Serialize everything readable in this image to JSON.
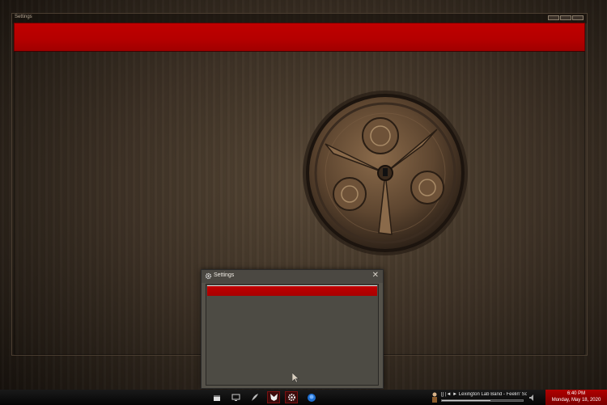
{
  "big_window": {
    "title": "Settings"
  },
  "small_window": {
    "title": "Settings",
    "close_glyph": "✕"
  },
  "taskbar": {
    "buttons": [
      {
        "icon": "calendar-icon"
      },
      {
        "icon": "monitor-icon"
      },
      {
        "icon": "feather-icon"
      },
      {
        "icon": "fox-icon"
      },
      {
        "icon": "gear-icon"
      },
      {
        "icon": "shield-icon"
      }
    ],
    "media": {
      "track": "[] |◄ ► Lexington Lab Band - Feelin' So"
    },
    "clock": {
      "time": "6:40 PM",
      "date": "Monday, May 18, 2020"
    }
  },
  "colors": {
    "accent": "#c00000",
    "window_bg": "#55524a"
  }
}
